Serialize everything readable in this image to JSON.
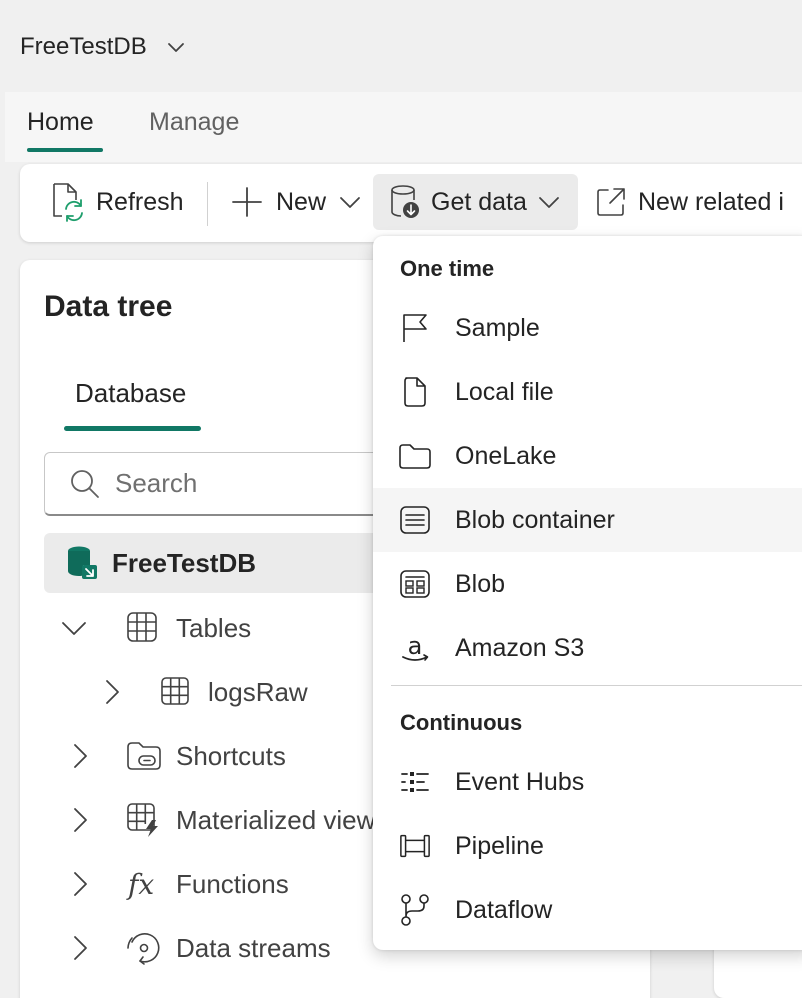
{
  "topbar": {
    "database_name": "FreeTestDB"
  },
  "tabs": {
    "home": "Home",
    "manage": "Manage"
  },
  "toolbar": {
    "refresh": "Refresh",
    "new": "New",
    "get_data": "Get data",
    "new_related": "New related i"
  },
  "panel": {
    "title": "Data tree",
    "tab": "Database",
    "search_placeholder": "Search",
    "tree": {
      "database": "FreeTestDB",
      "tables": "Tables",
      "logs_raw": "logsRaw",
      "shortcuts": "Shortcuts",
      "materialized_views": "Materialized views",
      "functions": "Functions",
      "data_streams": "Data streams"
    }
  },
  "menu": {
    "section_one_time": "One time",
    "section_continuous": "Continuous",
    "items": {
      "sample": "Sample",
      "local_file": "Local file",
      "onelake": "OneLake",
      "blob_container": "Blob container",
      "blob": "Blob",
      "amazon_s3": "Amazon S3",
      "event_hubs": "Event Hubs",
      "pipeline": "Pipeline",
      "dataflow": "Dataflow"
    }
  },
  "colors": {
    "accent": "#117865",
    "selected_bg": "#ebebeb",
    "hover_bg": "#f5f5f5"
  }
}
